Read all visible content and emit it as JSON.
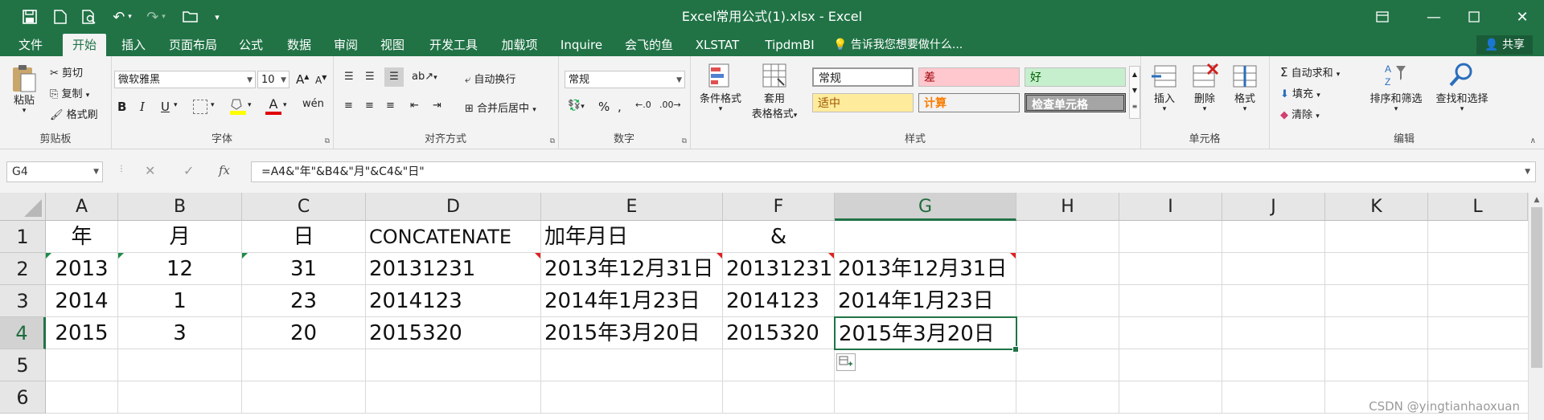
{
  "window": {
    "title": "Excel常用公式(1).xlsx - Excel"
  },
  "tabs": [
    {
      "label": "文件"
    },
    {
      "label": "开始"
    },
    {
      "label": "插入"
    },
    {
      "label": "页面布局"
    },
    {
      "label": "公式"
    },
    {
      "label": "数据"
    },
    {
      "label": "审阅"
    },
    {
      "label": "视图"
    },
    {
      "label": "开发工具"
    },
    {
      "label": "加载项"
    },
    {
      "label": "Inquire"
    },
    {
      "label": "会飞的鱼"
    },
    {
      "label": "XLSTAT"
    },
    {
      "label": "TipdmBI"
    }
  ],
  "tell_me": "告诉我您想要做什么...",
  "share": "共享",
  "ribbon": {
    "clipboard": {
      "paste": "粘贴",
      "cut": "剪切",
      "copy": "复制",
      "format_painter": "格式刷",
      "label": "剪贴板"
    },
    "font": {
      "name": "微软雅黑",
      "size": "10",
      "label": "字体",
      "grow": "A",
      "shrink": "A",
      "bold": "B",
      "italic": "I",
      "underline": "U",
      "fontcolor": "A"
    },
    "align": {
      "wrap": "自动换行",
      "merge": "合并后居中",
      "label": "对齐方式"
    },
    "number": {
      "format": "常规",
      "label": "数字"
    },
    "styles": {
      "cond": "条件格式",
      "table": "套用",
      "table2": "表格格式",
      "label": "样式",
      "cells": [
        "常规",
        "差",
        "好",
        "适中",
        "计算",
        "检查单元格"
      ]
    },
    "cells": {
      "insert": "插入",
      "delete": "删除",
      "format": "格式",
      "label": "单元格"
    },
    "editing": {
      "autosum": "自动求和",
      "fill": "填充",
      "clear": "清除",
      "sort": "排序和筛选",
      "find": "查找和选择",
      "label": "编辑"
    }
  },
  "formula_bar": {
    "name_box": "G4",
    "formula": "=A4&\"年\"&B4&\"月\"&C4&\"日\""
  },
  "columns": [
    "A",
    "B",
    "C",
    "D",
    "E",
    "F",
    "G",
    "H",
    "I",
    "J",
    "K",
    "L"
  ],
  "rows": [
    "1",
    "2",
    "3",
    "4",
    "5",
    "6"
  ],
  "cells": {
    "r1": [
      "年",
      "月",
      "日",
      "CONCATENATE",
      "加年月日",
      "&",
      ""
    ],
    "r2": [
      "2013",
      "12",
      "31",
      "20131231",
      "2013年12月31日",
      "20131231",
      "2013年12月31日"
    ],
    "r3": [
      "2014",
      "1",
      "23",
      "2014123",
      "2014年1月23日",
      "2014123",
      "2014年1月23日"
    ],
    "r4": [
      "2015",
      "3",
      "20",
      "2015320",
      "2015年3月20日",
      "2015320",
      "2015年3月20日"
    ]
  },
  "watermark": "CSDN @yingtianhaoxuan",
  "colors": {
    "excel_green": "#217346"
  }
}
